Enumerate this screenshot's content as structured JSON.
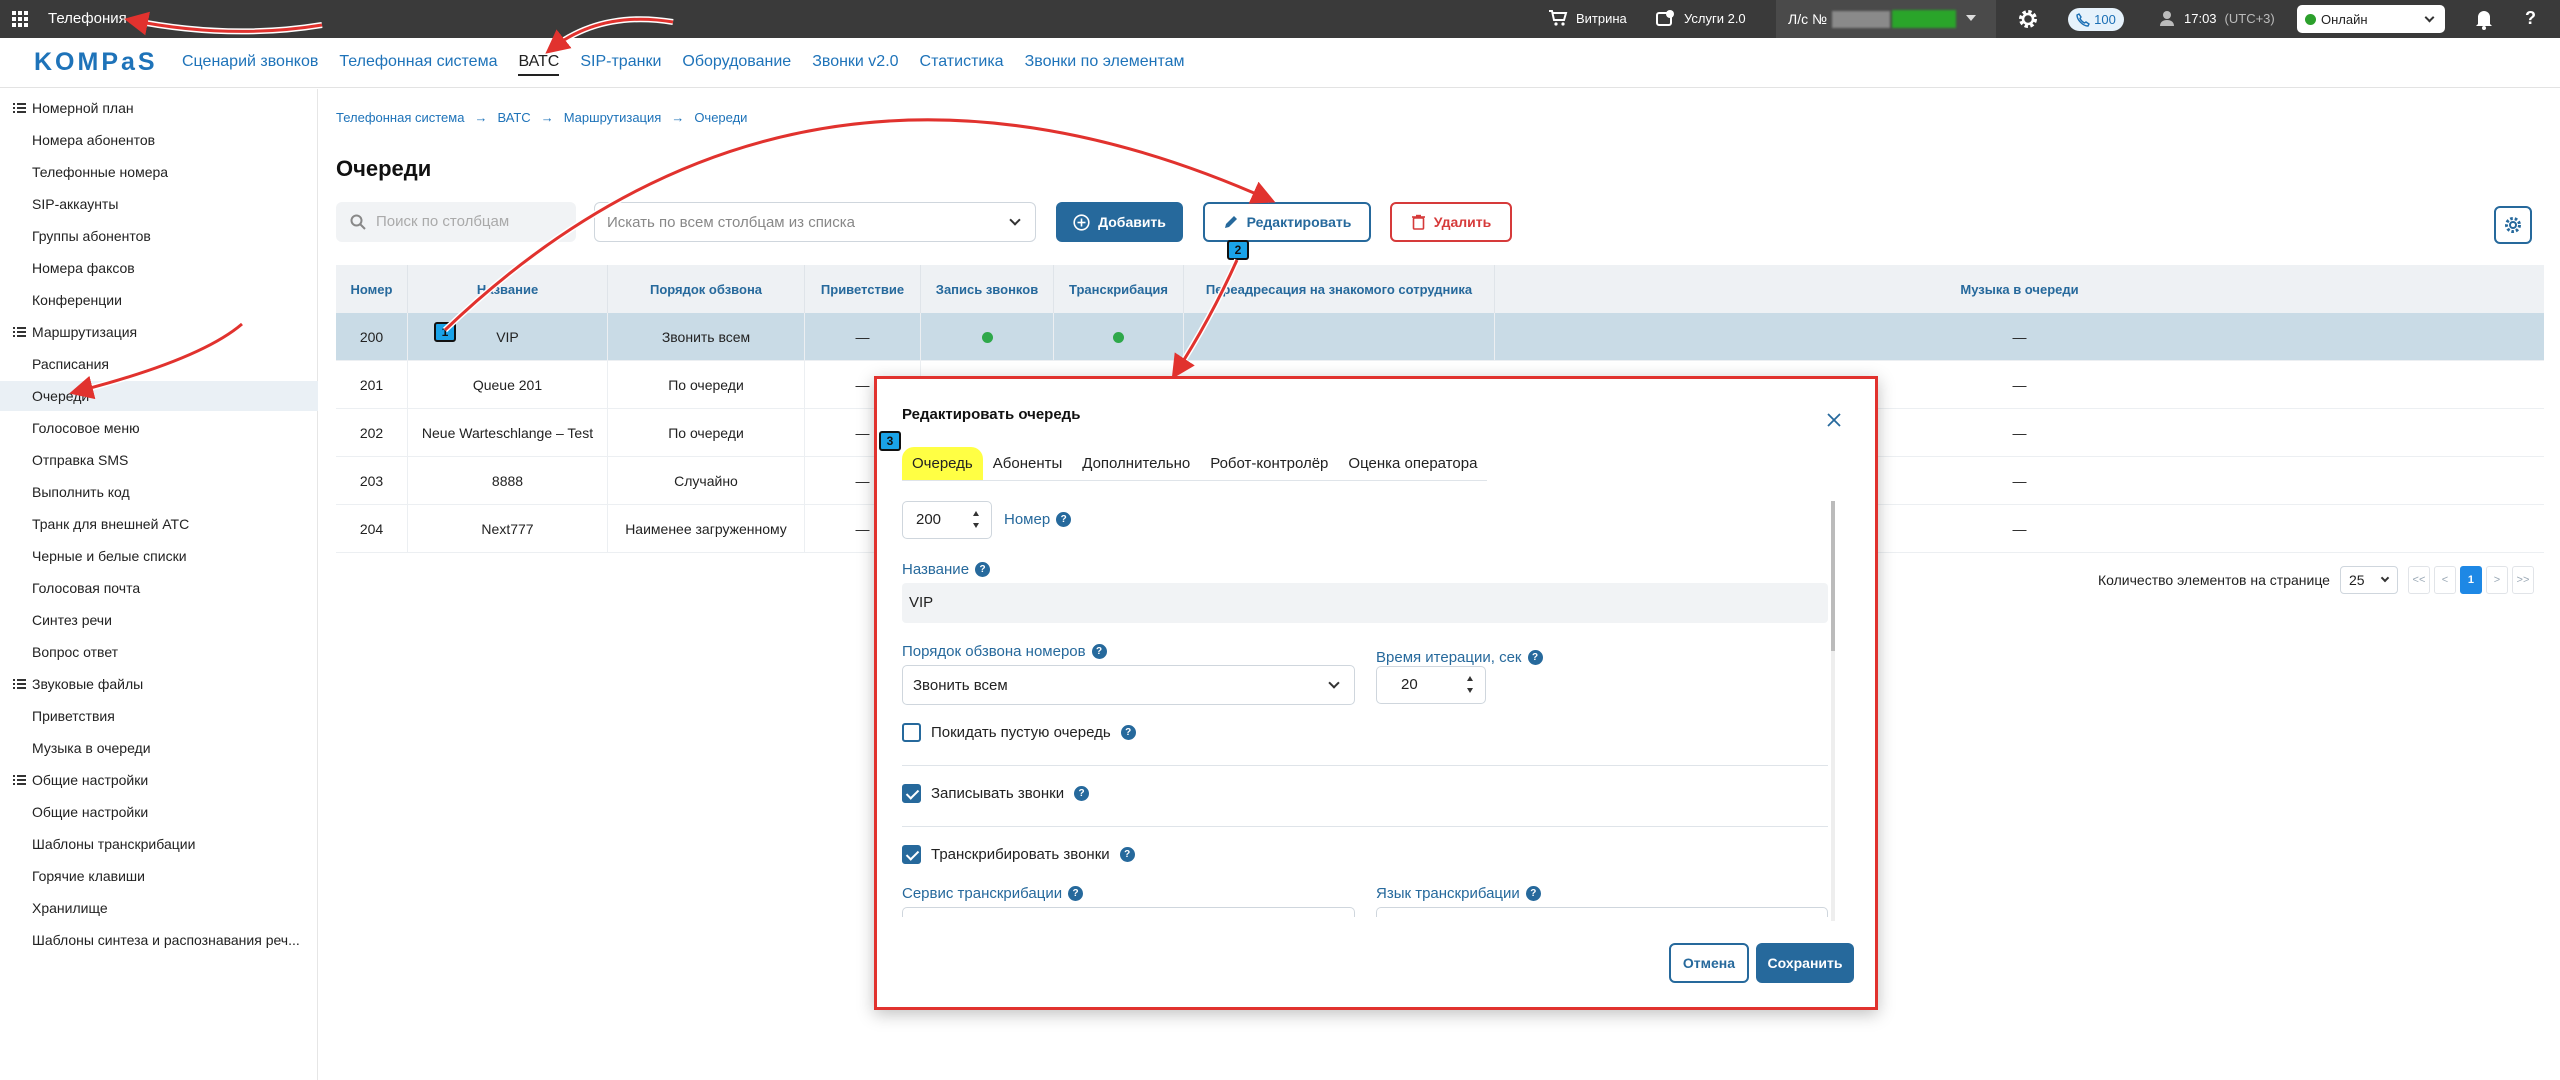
{
  "topbar": {
    "app_title": "Телефония",
    "vitrina": "Витрина",
    "services": "Услуги 2.0",
    "account_label": "Л/с №",
    "calls_badge": "100",
    "time": "17:03",
    "timezone": "(UTC+3)",
    "status": "Онлайн",
    "status_color": "#2ca02c"
  },
  "nav": {
    "logo": "KOMPaS",
    "links": [
      "Сценарий звонков",
      "Телефонная система",
      "ВАТС",
      "SIP-транки",
      "Оборудование",
      "Звонки v2.0",
      "Статистика",
      "Звонки по элементам"
    ],
    "active": "ВАТС"
  },
  "sidebar": {
    "items": [
      {
        "label": "Номерной план",
        "group": true
      },
      {
        "label": "Номера абонентов"
      },
      {
        "label": "Телефонные номера"
      },
      {
        "label": "SIP-аккаунты"
      },
      {
        "label": "Группы абонентов"
      },
      {
        "label": "Номера факсов"
      },
      {
        "label": "Конференции"
      },
      {
        "label": "Маршрутизация",
        "group": true
      },
      {
        "label": "Расписания"
      },
      {
        "label": "Очереди",
        "active": true
      },
      {
        "label": "Голосовое меню"
      },
      {
        "label": "Отправка SMS"
      },
      {
        "label": "Выполнить код"
      },
      {
        "label": "Транк для внешней АТС"
      },
      {
        "label": "Черные и белые списки"
      },
      {
        "label": "Голосовая почта"
      },
      {
        "label": "Синтез речи"
      },
      {
        "label": "Вопрос ответ"
      },
      {
        "label": "Звуковые файлы",
        "group": true
      },
      {
        "label": "Приветствия"
      },
      {
        "label": "Музыка в очереди"
      },
      {
        "label": "Общие настройки",
        "group": true
      },
      {
        "label": "Общие настройки"
      },
      {
        "label": "Шаблоны транскрибации"
      },
      {
        "label": "Горячие клавиши"
      },
      {
        "label": "Хранилище"
      },
      {
        "label": "Шаблоны синтеза и распознавания реч..."
      }
    ]
  },
  "breadcrumb": [
    "Телефонная система",
    "ВАТС",
    "Маршрутизация",
    "Очереди"
  ],
  "page_title": "Очереди",
  "toolbar": {
    "search_placeholder": "Поиск по столбцам",
    "search_all_placeholder": "Искать по всем столбцам из списка",
    "add": "Добавить",
    "edit": "Редактировать",
    "delete": "Удалить"
  },
  "table": {
    "columns": [
      "Номер",
      "Название",
      "Порядок обзвона",
      "Приветствие",
      "Запись звонков",
      "Транскрибация",
      "Переадресация на знакомого сотрудника",
      "Музыка в очереди"
    ],
    "rows": [
      {
        "num": "200",
        "name": "VIP",
        "order": "Звонить всем",
        "greeting": "—",
        "rec": true,
        "trans": true,
        "music": "—",
        "selected": true
      },
      {
        "num": "201",
        "name": "Queue 201",
        "order": "По очереди",
        "greeting": "—",
        "music": "—"
      },
      {
        "num": "202",
        "name": "Neue Warteschlange – Test",
        "order": "По очереди",
        "greeting": "—",
        "music": "—"
      },
      {
        "num": "203",
        "name": "8888",
        "order": "Случайно",
        "greeting": "—",
        "music": "—"
      },
      {
        "num": "204",
        "name": "Next777",
        "order": "Наименее загруженному",
        "greeting": "—",
        "music": "—"
      }
    ]
  },
  "pager": {
    "label": "Количество элементов на странице",
    "per_page": "25",
    "first": "<<",
    "prev": "<",
    "page": "1",
    "next": ">",
    "last": ">>"
  },
  "modal": {
    "title": "Редактировать очередь",
    "tabs": [
      "Очередь",
      "Абоненты",
      "Дополнительно",
      "Робот-контролёр",
      "Оценка оператора"
    ],
    "active_tab": "Очередь",
    "number_value": "200",
    "number_label": "Номер",
    "name_label": "Название",
    "name_value": "VIP",
    "order_label": "Порядок обзвона номеров",
    "order_value": "Звонить всем",
    "iter_label": "Время итерации, сек",
    "iter_value": "20",
    "leave_empty": "Покидать пустую очередь",
    "leave_empty_checked": false,
    "record_calls": "Записывать звонки",
    "record_calls_checked": true,
    "transcribe_calls": "Транскрибировать звонки",
    "transcribe_calls_checked": true,
    "trans_service_label": "Сервис транскрибации",
    "trans_lang_label": "Язык транскрибации",
    "cancel": "Отмена",
    "save": "Сохранить"
  },
  "markers": [
    "1",
    "2",
    "3"
  ],
  "help_glyph": "?",
  "colors": {
    "accent": "#26699c",
    "link": "#1e73b9",
    "danger": "#d63a3a",
    "annotation": "#e1322e",
    "highlight": "#ffff44",
    "ok": "#2ea84a"
  }
}
